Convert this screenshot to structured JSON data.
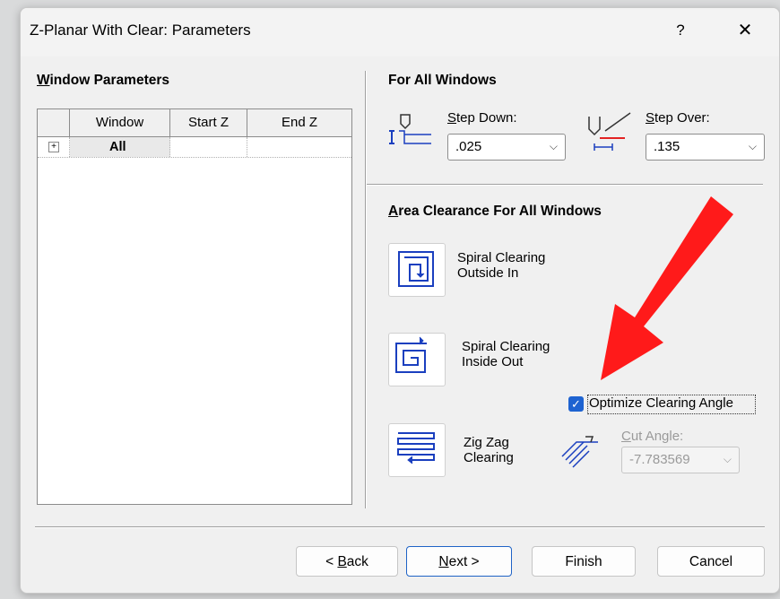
{
  "window": {
    "title": "Z-Planar With Clear: Parameters",
    "help": "?",
    "close": "✕"
  },
  "window_params": {
    "heading_first": "W",
    "heading_rest": "indow Parameters",
    "columns": [
      "Window",
      "Start Z",
      "End Z"
    ],
    "rows": [
      {
        "expand": "+",
        "window": "All",
        "start_z": "",
        "end_z": ""
      }
    ]
  },
  "all_windows": {
    "heading": "For All Windows",
    "step_down": {
      "label_first": "S",
      "label_rest": "tep Down:",
      "value": ".025"
    },
    "step_over": {
      "label_first": "S",
      "label_rest": "tep Over:",
      "value": ".135"
    }
  },
  "area_clearance": {
    "heading_first": "A",
    "heading_rest": "rea Clearance For All Windows",
    "spiral_out_in": "Spiral Clearing\nOutside In",
    "spiral_in_out": "Spiral Clearing\nInside Out",
    "optimize": {
      "label": "Optimize Clearing Angle",
      "checked": true
    },
    "zig_zag": "Zig Zag\nClearing",
    "cut_angle": {
      "label_first": "C",
      "label_rest": "ut Angle:",
      "value": "-7.783569"
    }
  },
  "buttons": {
    "back": {
      "prefix": "< ",
      "accel": "B",
      "rest": "ack"
    },
    "next": {
      "accel": "N",
      "rest": "ext >"
    },
    "finish": "Finish",
    "cancel": "Cancel"
  },
  "colors": {
    "accent": "#1e63d1",
    "annotation_arrow": "#ff1a1a",
    "icon_blue": "#1a3fbf"
  }
}
